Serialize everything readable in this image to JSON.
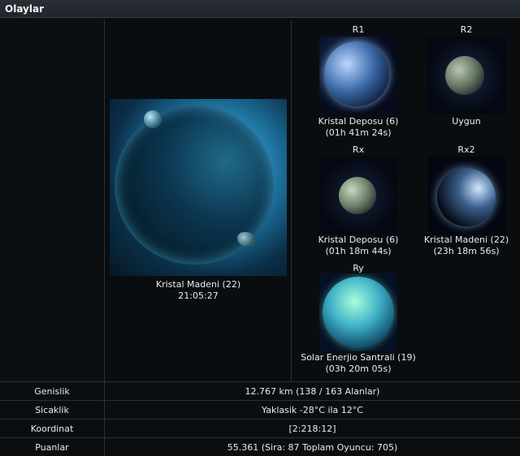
{
  "header": {
    "title": "Olaylar"
  },
  "main_planet": {
    "name_label": "Kristal Madeni (22)",
    "time_label": "21:05:27"
  },
  "slots": [
    {
      "id": "R1",
      "title": "Kristal Deposu (6)",
      "subtitle": "(01h 41m 24s)",
      "icon": "planet-icon"
    },
    {
      "id": "R2",
      "title": "Uygun",
      "subtitle": "",
      "icon": "planet-icon"
    },
    {
      "id": "Rx",
      "title": "Kristal Deposu (6)",
      "subtitle": "(01h 18m 44s)",
      "icon": "planet-icon"
    },
    {
      "id": "Rx2",
      "title": "Kristal Madeni (22)",
      "subtitle": "(23h 18m 56s)",
      "icon": "planet-icon"
    },
    {
      "id": "Ry",
      "title": "Solar Enerjio Santrali (19)",
      "subtitle": "(03h 20m 05s)",
      "icon": "planet-icon"
    }
  ],
  "info_rows": [
    {
      "key": "Genislik",
      "value": "12.767 km (138 / 163 Alanlar)"
    },
    {
      "key": "Sicaklik",
      "value": "Yaklasik -28°C ila 12°C"
    },
    {
      "key": "Koordinat",
      "value": "[2:218:12]"
    },
    {
      "key": "Puanlar",
      "value": "55.361 (Sira: 87 Toplam Oyuncu: 705)"
    }
  ],
  "colors": {
    "accent": "#5ad0ff",
    "text": "#e9edf2",
    "muted": "#8f969e",
    "panel_bg": "#0b0e11",
    "divider": "#2c3137"
  }
}
